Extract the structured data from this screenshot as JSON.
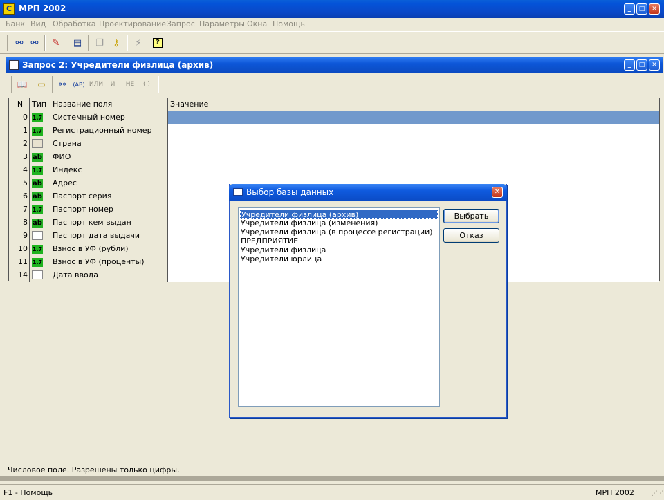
{
  "app": {
    "title": "МРП 2002",
    "icon_letter": "С"
  },
  "menu": [
    "Банк",
    "Вид",
    "Обработка",
    "Проектирование",
    "Запрос",
    "Параметры",
    "Окна",
    "Помощь"
  ],
  "child": {
    "title": "Запрос 2: Учредители физлица (архив)",
    "toolbar_text": {
      "or": "ИЛИ",
      "and": "И",
      "not": "НЕ",
      "parens": "( )"
    },
    "status": "Числовое поле. Разрешены только цифры."
  },
  "grid": {
    "headers": {
      "n": "N",
      "type": "Тип",
      "name": "Название поля",
      "value": "Значение"
    },
    "rows": [
      {
        "n": "0",
        "type": "1.7",
        "name": "Системный номер"
      },
      {
        "n": "1",
        "type": "1.7",
        "name": "Регистрационный номер"
      },
      {
        "n": "2",
        "type": "",
        "name": "Страна"
      },
      {
        "n": "3",
        "type": "ab",
        "name": "ФИО"
      },
      {
        "n": "4",
        "type": "1.7",
        "name": "Индекс"
      },
      {
        "n": "5",
        "type": "ab",
        "name": "Адрес"
      },
      {
        "n": "6",
        "type": "ab",
        "name": "Паспорт серия"
      },
      {
        "n": "7",
        "type": "1.7",
        "name": "Паспорт номер"
      },
      {
        "n": "8",
        "type": "ab",
        "name": "Паспорт кем выдан"
      },
      {
        "n": "9",
        "type": "",
        "name": "Паспорт дата выдачи"
      },
      {
        "n": "10",
        "type": "1.7",
        "name": "Взнос в УФ (рубли)"
      },
      {
        "n": "11",
        "type": "1.7",
        "name": "Взнос в УФ (проценты)"
      },
      {
        "n": "14",
        "type": "",
        "name": "Дата ввода"
      }
    ]
  },
  "dialog": {
    "title": "Выбор базы данных",
    "items": [
      "Учредители физлица (архив)",
      "Учредители физлица (изменения)",
      "Учредители физлица (в процессе регистрации)",
      "ПРЕДПРИЯТИЕ",
      "Учредители физлица",
      "Учредители юрлица"
    ],
    "select_button": "Выбрать",
    "cancel_button": "Отказ"
  },
  "statusbar": {
    "left": "F1 - Помощь",
    "right": "МРП 2002"
  }
}
